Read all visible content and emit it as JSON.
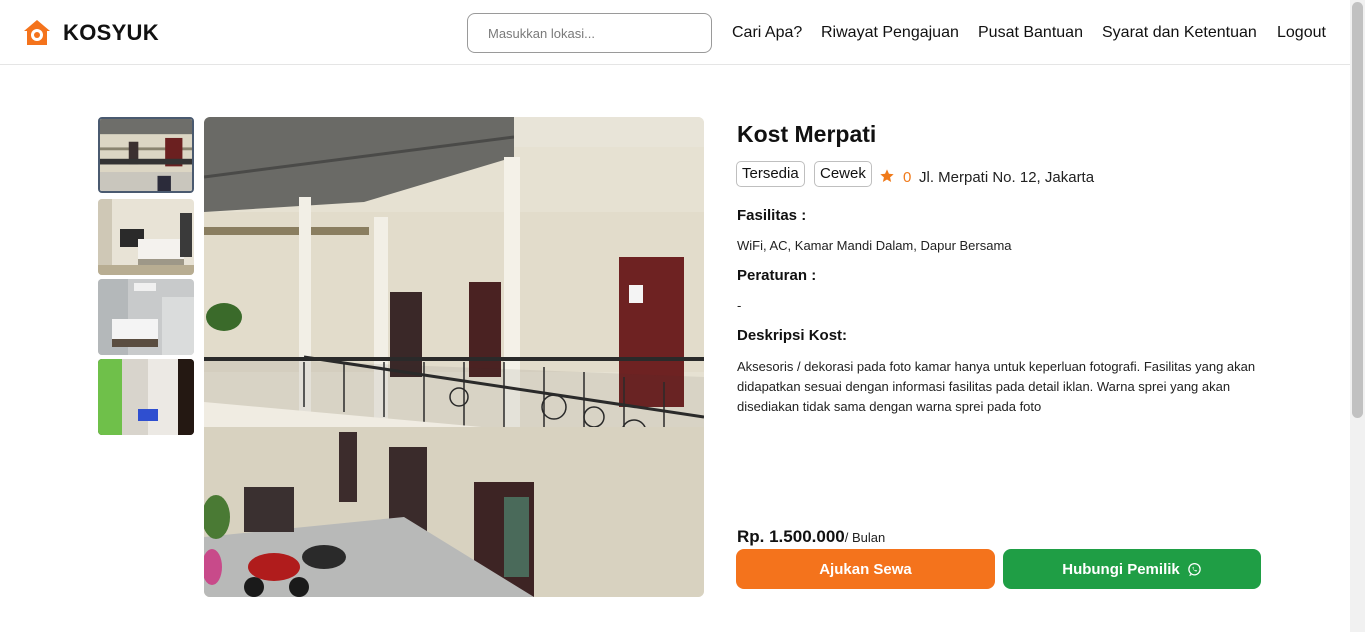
{
  "header": {
    "logo_text": "KOSYUK",
    "search_placeholder": "Masukkan lokasi...",
    "nav": [
      "Cari Apa?",
      "Riwayat Pengajuan",
      "Pusat Bantuan",
      "Syarat dan Ketentuan",
      "Logout"
    ]
  },
  "property": {
    "title": "Kost Merpati",
    "tags": [
      "Tersedia",
      "Cewek"
    ],
    "rating": "0",
    "address": "Jl. Merpati No. 12, Jakarta",
    "facilities_label": "Fasilitas :",
    "facilities": "WiFi, AC, Kamar Mandi Dalam, Dapur Bersama",
    "rules_label": "Peraturan :",
    "rules": "-",
    "description_label": "Deskripsi Kost:",
    "description": "Aksesoris / dekorasi pada foto kamar hanya untuk keperluan fotografi. Fasilitas yang akan didapatkan sesuai dengan informasi fasilitas pada detail iklan. Warna sprei yang akan disediakan tidak sama dengan warna sprei pada foto",
    "price": "Rp. 1.500.000",
    "price_unit": "/ Bulan"
  },
  "actions": {
    "apply_label": "Ajukan Sewa",
    "contact_label": "Hubungi Pemilik"
  },
  "gallery": {
    "thumbnails": [
      "building-corridor-photo",
      "bedroom-photo",
      "bedroom-ac-photo",
      "bathroom-photo"
    ],
    "active_index": 0
  },
  "colors": {
    "brand": "#f4731c",
    "whatsapp_green": "#1f9e45",
    "star": "#f07a1a"
  },
  "icons": [
    "house-logo-icon",
    "star-icon",
    "whatsapp-icon"
  ]
}
